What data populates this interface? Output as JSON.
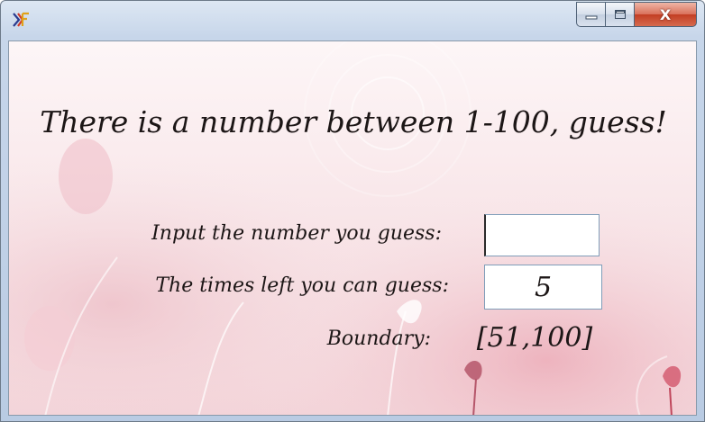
{
  "window": {
    "title": "",
    "icon": "app-logo-icon",
    "controls": {
      "minimize_icon": "minimize-icon",
      "maximize_icon": "maximize-icon",
      "close_icon": "close-icon",
      "close_glyph": "X"
    }
  },
  "game": {
    "headline": "There is a number between 1-100, guess!",
    "input_label": "Input the number you guess:",
    "input_value": "",
    "times_label": "The times left you can guess:",
    "times_value": "5",
    "boundary_label": "Boundary:",
    "boundary_value": "[51,100]"
  },
  "colors": {
    "background": "#f6e3e6",
    "text": "#1c1616",
    "close_button": "#c23e23"
  }
}
